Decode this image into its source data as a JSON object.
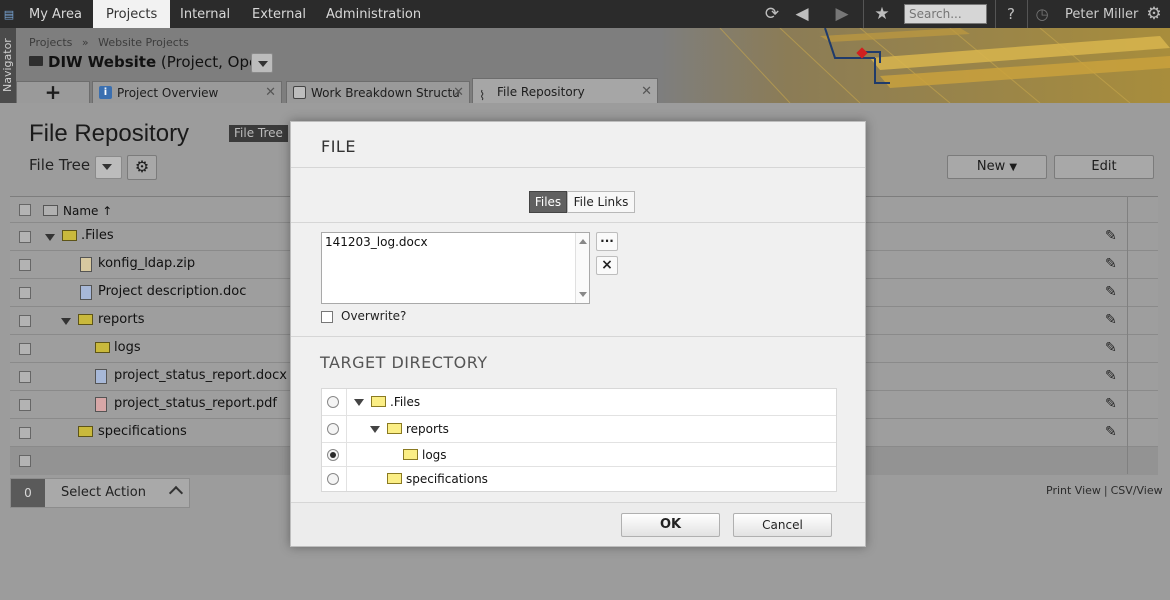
{
  "topbar": {
    "menu": [
      "My Area",
      "Projects",
      "Internal",
      "External",
      "Administration"
    ],
    "active": "Projects",
    "search_placeholder": "Search...",
    "user": "Peter Miller",
    "icons": [
      "refresh-icon",
      "back-icon",
      "forward-icon",
      "favorite-star-icon",
      "help-icon",
      "timer-icon",
      "gear-icon"
    ]
  },
  "navigator": {
    "label": "Navigator"
  },
  "header": {
    "breadcrumb": [
      "Projects",
      "»",
      "Website Projects"
    ],
    "project_name": "DIW Website",
    "project_status": "(Project, Open)"
  },
  "tabs": {
    "add_label": "+",
    "items": [
      {
        "label": "Project Overview",
        "icon": "info-icon",
        "active": false
      },
      {
        "label": "Work Breakdown Structu",
        "icon": "wbs-icon",
        "active": false
      },
      {
        "label": "File Repository",
        "icon": "paperclip-icon",
        "active": true
      }
    ]
  },
  "page": {
    "title": "File Repository",
    "view_chip": "File Tree",
    "view_label": "File Tree",
    "new_button": "New",
    "edit_button": "Edit",
    "column_name": "Name"
  },
  "grid": {
    "rows": [
      {
        "name": ".Files",
        "type": "folder",
        "level": 0,
        "expanded": true
      },
      {
        "name": "konfig_ldap.zip",
        "type": "zip",
        "level": 1
      },
      {
        "name": "Project description.doc",
        "type": "word",
        "level": 1
      },
      {
        "name": "reports",
        "type": "folder",
        "level": 1,
        "expanded": true
      },
      {
        "name": "logs",
        "type": "folder",
        "level": 2
      },
      {
        "name": "project_status_report.docx",
        "type": "word",
        "level": 2
      },
      {
        "name": "project_status_report.pdf",
        "type": "pdf",
        "level": 2
      },
      {
        "name": "specifications",
        "type": "folder",
        "level": 1
      }
    ]
  },
  "action_bar": {
    "count": "0",
    "label": "Select Action"
  },
  "print_links": {
    "print": "Print View",
    "sep": "|",
    "csv": "CSV/View"
  },
  "dialog": {
    "title": "FILE",
    "seg_files": "Files",
    "seg_links": "File Links",
    "files": [
      "141203_log.docx"
    ],
    "browse_label": "···",
    "remove_label": "×",
    "overwrite_label": "Overwrite?",
    "target_title": "TARGET DIRECTORY",
    "tree": [
      {
        "name": ".Files",
        "level": 0,
        "expanded": true,
        "selected": false
      },
      {
        "name": "reports",
        "level": 1,
        "expanded": true,
        "selected": false
      },
      {
        "name": "logs",
        "level": 2,
        "expanded": false,
        "selected": true
      },
      {
        "name": "specifications",
        "level": 1,
        "expanded": false,
        "selected": false
      }
    ],
    "ok": "OK",
    "cancel": "Cancel"
  }
}
